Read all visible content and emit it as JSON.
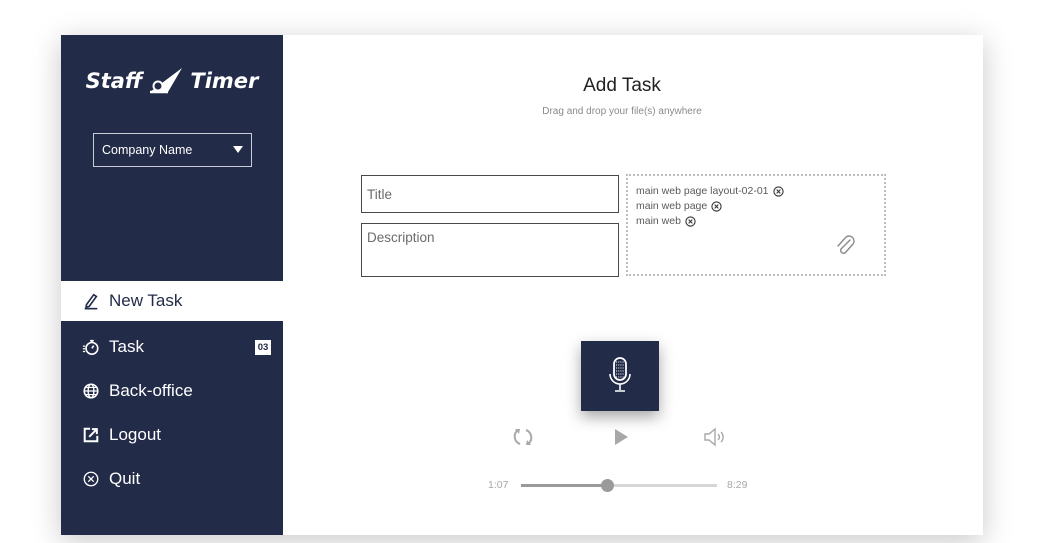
{
  "app": {
    "logo_left": "Staff",
    "logo_right": "Timer"
  },
  "sidebar": {
    "company_select": {
      "value": "Company Name"
    },
    "items": [
      {
        "label": "New Task",
        "icon": "pencil-icon",
        "active": true
      },
      {
        "label": "Task",
        "icon": "stopwatch-icon",
        "badge": "03"
      },
      {
        "label": "Back-office",
        "icon": "globe-icon"
      },
      {
        "label": "Logout",
        "icon": "logout-icon"
      },
      {
        "label": "Quit",
        "icon": "close-circle-icon"
      }
    ]
  },
  "main": {
    "title": "Add Task",
    "subtitle": "Drag and drop your file(s) anywhere",
    "title_field": {
      "placeholder": "Title",
      "value": ""
    },
    "description_field": {
      "placeholder": "Description",
      "value": ""
    },
    "attachments": [
      {
        "name": "main web page layout-02-01"
      },
      {
        "name": "main web page"
      },
      {
        "name": "main web"
      }
    ],
    "attach_icon": "paperclip-icon",
    "record_icon": "microphone-icon"
  },
  "player": {
    "current_time": "1:07",
    "total_time": "8:29",
    "progress": 0.44,
    "controls": [
      "repeat-icon",
      "play-icon",
      "volume-icon"
    ]
  },
  "colors": {
    "sidebar_bg": "#222b48",
    "accent": "#222b48",
    "muted": "#9a9a9a"
  }
}
